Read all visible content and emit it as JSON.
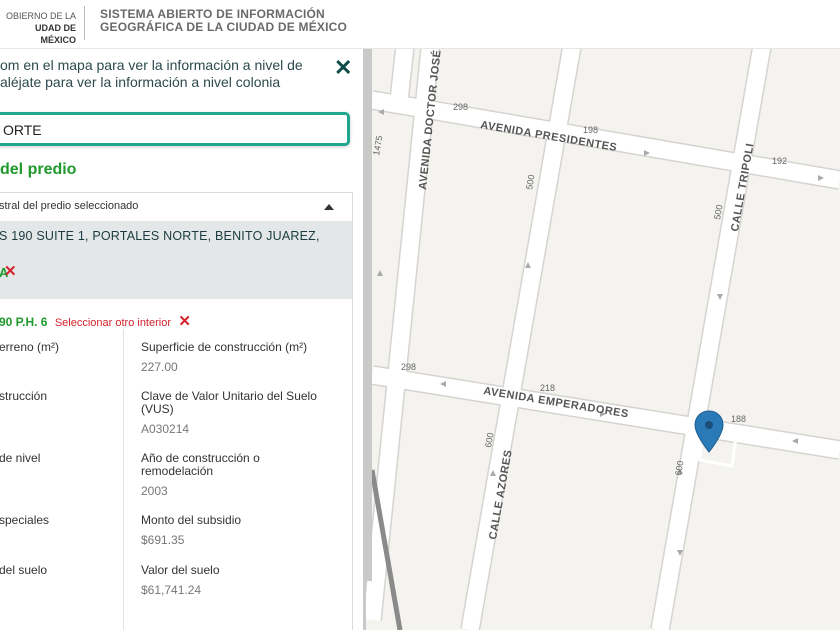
{
  "header": {
    "logo_line1": "OBIERNO DE LA",
    "logo_line2": "UDAD DE MÉXICO",
    "title_line1": "SISTEMA ABIERTO DE INFORMACIÓN",
    "title_line2": "GEOGRÁFICA DE LA CIUDAD DE MÉXICO"
  },
  "panel": {
    "instruction_line1": "om en el mapa para ver la información a nivel de",
    "instruction_line2": "aléjate para ver la información a nivel colonia",
    "search_value": "ORTE",
    "section_title": "del predio",
    "card_header": "stral del predio seleccionado",
    "address": "S 190 SUITE 1, PORTALES NORTE, BENITO JUAREZ,",
    "address_suffix": "A",
    "interior_code": "90 P.H. 6",
    "interior_select": "Seleccionar otro interior",
    "fields_left": [
      {
        "label": "erreno (m²)",
        "value": ""
      },
      {
        "label": "strucción",
        "value": ""
      },
      {
        "label": "de nivel",
        "value": ""
      },
      {
        "label": "speciales",
        "value": ""
      },
      {
        "label": "del suelo",
        "value": ""
      }
    ],
    "fields_right": [
      {
        "label": "Superficie de construcción (m²)",
        "value": "227.00"
      },
      {
        "label": "Clave de Valor Unitario del Suelo (VUS)",
        "value": "A030214"
      },
      {
        "label": "Año de construcción o remodelación",
        "value": "2003"
      },
      {
        "label": "Monto del subsidio",
        "value": "$691.35"
      },
      {
        "label": "Valor del suelo",
        "value": "$61,741.24"
      }
    ]
  },
  "map": {
    "streets": {
      "doctor_jose_maria": "AVENIDA DOCTOR JOSÉ MARÍA",
      "presidentes": "AVENIDA PRESIDENTES",
      "tripoli": "CALLE TRIPOLI",
      "emperadores": "AVENIDA EMPERADORES",
      "azores": "CALLE AZORES"
    },
    "numbers": [
      "1475",
      "298",
      "198",
      "192",
      "500",
      "500",
      "298",
      "218",
      "188",
      "600",
      "600"
    ],
    "marker_color": "#2a7ab8"
  }
}
